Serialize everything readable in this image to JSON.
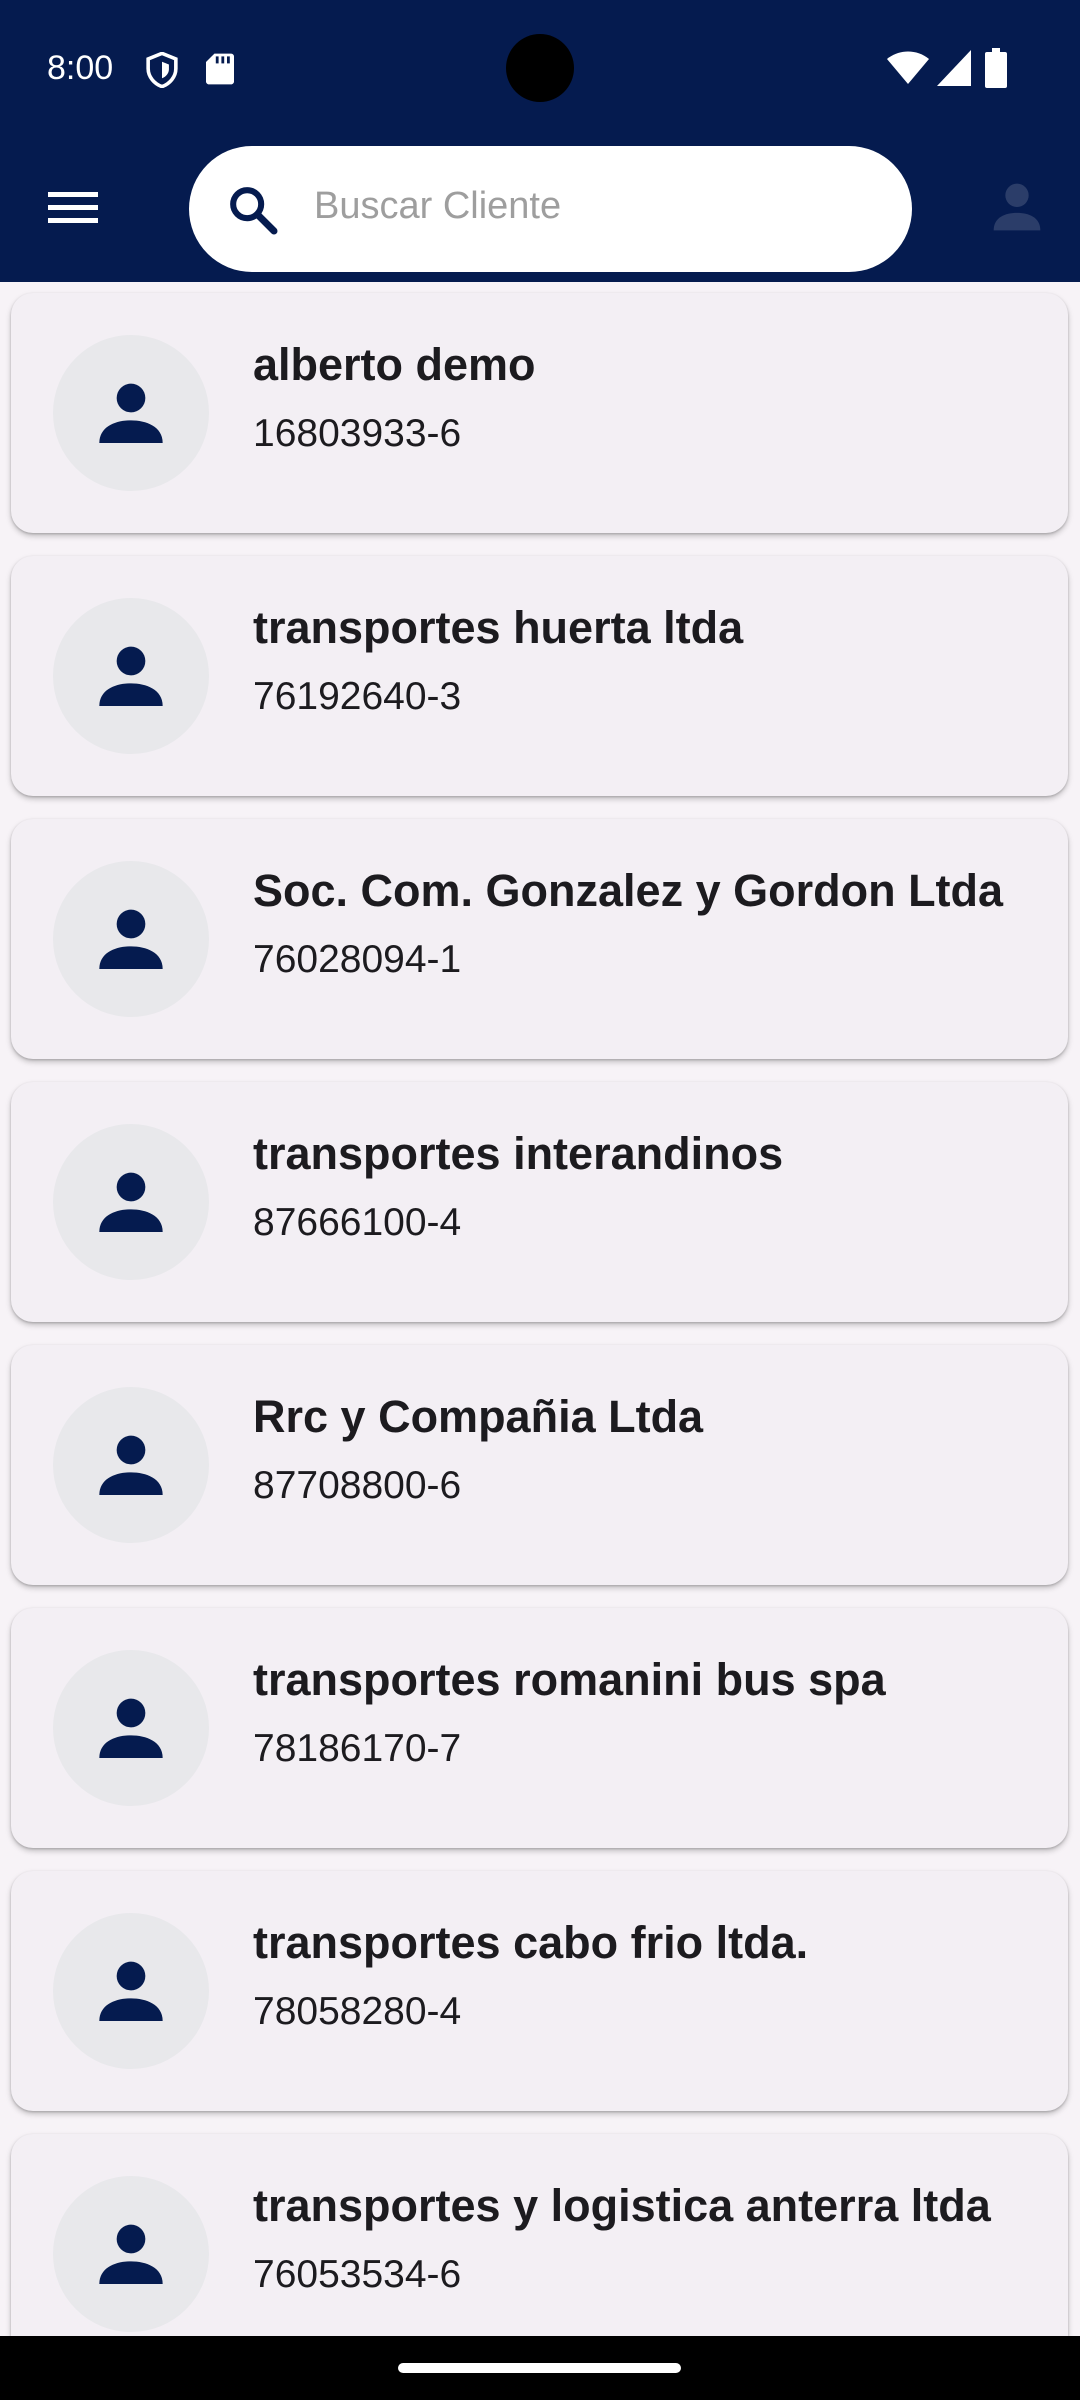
{
  "status_bar": {
    "time": "8:00",
    "icons": [
      "shield-icon",
      "sd-card-icon",
      "wifi-icon",
      "cellular-signal-icon",
      "battery-icon"
    ]
  },
  "colors": {
    "header_bg": "#051b4f",
    "accent": "#051b4f",
    "card_bg": "#f3eff4",
    "page_bg": "#f7f3f7",
    "avatar_bg": "#e8e8eb"
  },
  "search": {
    "placeholder": "Buscar Cliente",
    "value": ""
  },
  "clients": [
    {
      "name": "alberto demo",
      "rut": "16803933-6"
    },
    {
      "name": "transportes huerta ltda",
      "rut": "76192640-3"
    },
    {
      "name": "Soc. Com. Gonzalez y Gordon Ltda",
      "rut": "76028094-1"
    },
    {
      "name": "transportes interandinos",
      "rut": "87666100-4"
    },
    {
      "name": "Rrc y Compañia Ltda",
      "rut": "87708800-6"
    },
    {
      "name": "transportes romanini bus spa",
      "rut": "78186170-7"
    },
    {
      "name": "transportes cabo frio ltda.",
      "rut": "78058280-4"
    },
    {
      "name": "transportes y logistica anterra ltda",
      "rut": "76053534-6"
    }
  ]
}
